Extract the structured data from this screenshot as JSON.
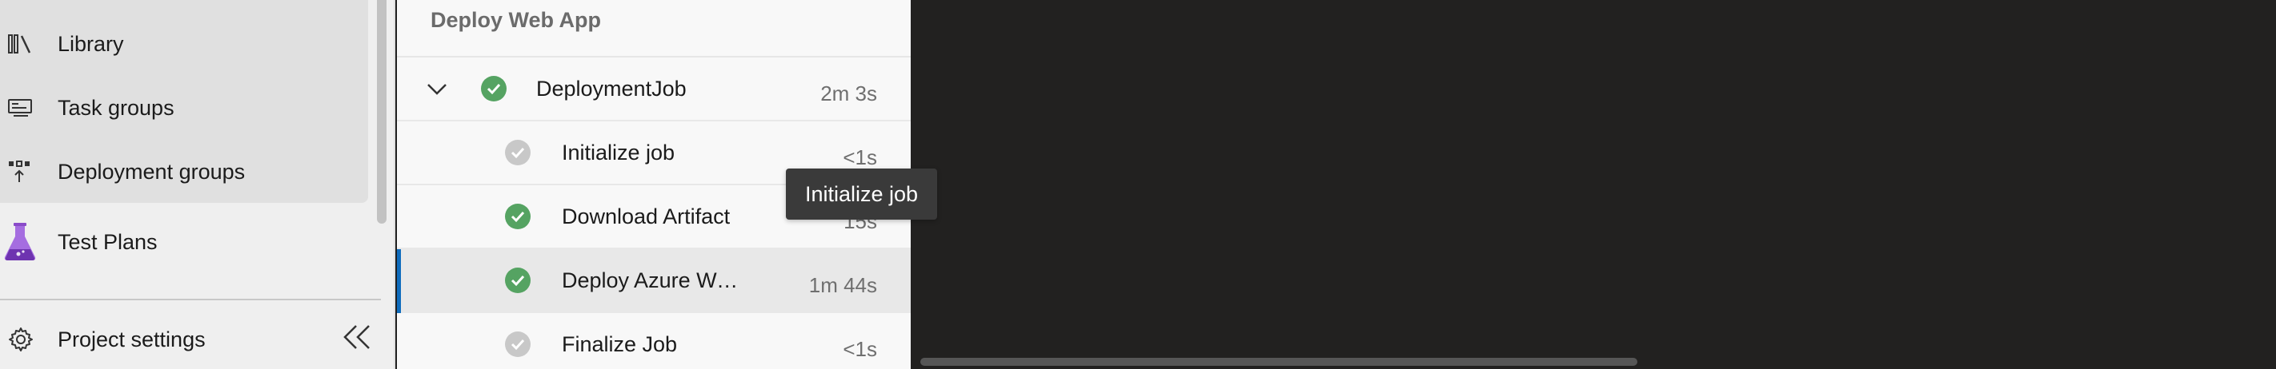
{
  "sidebar": {
    "items": [
      {
        "id": "library",
        "label": "Library",
        "icon": "library-icon"
      },
      {
        "id": "task-groups",
        "label": "Task groups",
        "icon": "task-groups-icon"
      },
      {
        "id": "deployment-groups",
        "label": "Deployment groups",
        "icon": "deployment-groups-icon"
      },
      {
        "id": "test-plans",
        "label": "Test Plans",
        "icon": "test-plans-icon"
      }
    ],
    "settings": {
      "label": "Project settings",
      "icon": "gear-icon"
    },
    "collapse_icon": "double-chevron-left-icon"
  },
  "job_panel": {
    "stage_title": "Deploy Web App",
    "job": {
      "name": "DeploymentJob",
      "duration": "2m 3s",
      "status": "succeeded",
      "expanded": true
    },
    "steps": [
      {
        "name": "Initialize job",
        "duration": "<1s",
        "status": "skipped-neutral"
      },
      {
        "name": "Download Artifact",
        "duration": "15s",
        "status": "succeeded"
      },
      {
        "name": "Deploy Azure Web App",
        "duration": "1m 44s",
        "status": "succeeded",
        "selected": true
      },
      {
        "name": "Finalize Job",
        "duration": "<1s",
        "status": "skipped-neutral"
      }
    ]
  },
  "tooltip": {
    "text": "Initialize job"
  },
  "colors": {
    "success": "#55a362",
    "neutral": "#c8c8c8",
    "selection_accent": "#0f6cbd",
    "log_background": "#222120",
    "test_plans_purple": "#8a4bc9"
  }
}
